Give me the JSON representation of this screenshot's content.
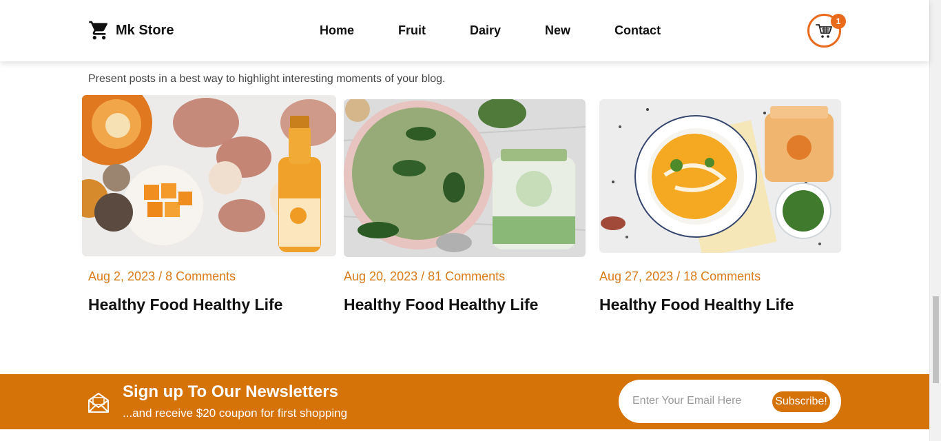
{
  "header": {
    "brand": "Mk Store",
    "nav": [
      "Home",
      "Fruit",
      "Dairy",
      "New",
      "Contact"
    ],
    "cart_count": "1"
  },
  "blog": {
    "intro": "Present posts in a best way to highlight interesting moments of your blog.",
    "posts": [
      {
        "meta": "Aug 2, 2023 / 8 Comments",
        "title": "Healthy Food Healthy Life"
      },
      {
        "meta": "Aug 20, 2023 / 81 Comments",
        "title": "Healthy Food Healthy Life"
      },
      {
        "meta": "Aug 27, 2023 / 18 Comments",
        "title": "Healthy Food Healthy Life"
      }
    ]
  },
  "newsletter": {
    "title": "Sign up To Our Newsletters",
    "subtitle": "...and receive $20 coupon for first shopping",
    "placeholder": "Enter Your Email Here",
    "button": "Subscribe!"
  },
  "colors": {
    "accent": "#d57309",
    "meta_text": "#d97b1a",
    "cart_ring": "#ea6a1c"
  }
}
